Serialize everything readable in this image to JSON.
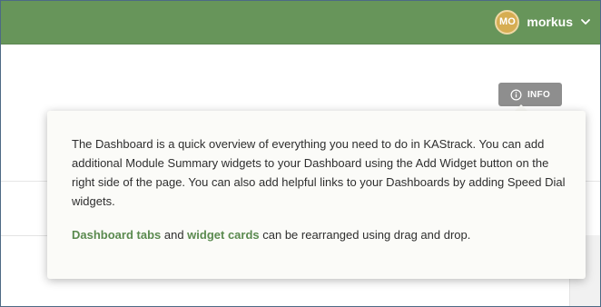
{
  "user": {
    "initials": "MO",
    "name": "morkus",
    "menu_icon": "chevron-down-icon"
  },
  "info_button": {
    "label": "INFO",
    "icon": "info-circle-icon"
  },
  "popover": {
    "paragraph": "The Dashboard is a quick overview of everything you need to do in KAStrack. You can add additional Module Summary widgets to your Dashboard using the Add Widget button on the right side of the page. You can also add helpful links to your Dashboards by adding Speed Dial widgets.",
    "link_tabs": "Dashboard tabs",
    "text_and": " and ",
    "link_cards": "widget cards",
    "text_tail": " can be rearranged using drag and drop."
  },
  "colors": {
    "topbar": "#67955a",
    "link": "#5a8a4f",
    "avatar": "#d6ad52",
    "info_button": "#8e8e8e"
  }
}
